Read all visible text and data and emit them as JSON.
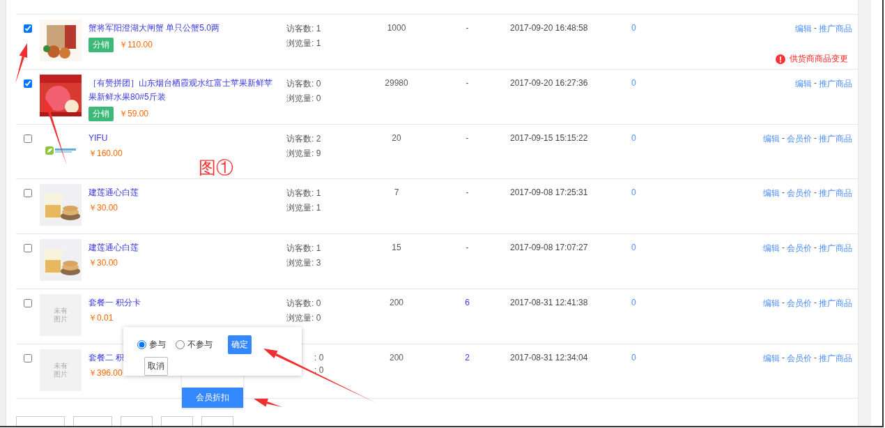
{
  "products": [
    {
      "checked": true,
      "image": {
        "kind": "picture"
      },
      "title": "蟹将军阳澄湖大闸蟹 单只公蟹5.0两",
      "badge": "分销",
      "price": "￥110.00",
      "stats": [
        "访客数: 1",
        "浏览量: 1"
      ],
      "stock": "1000",
      "column_5": {
        "text": "-",
        "link": false
      },
      "created": "2017-09-20 16:48:58",
      "column_7": "0",
      "actions": [
        {
          "kind": "link",
          "text": "编辑"
        },
        {
          "kind": "separator",
          "text": "-"
        },
        {
          "kind": "link",
          "text": "推广商品"
        }
      ],
      "warning": "供货商商品变更"
    },
    {
      "checked": true,
      "image": {
        "kind": "picture"
      },
      "title": "［有赞拼团］山东烟台栖霞观水红富士苹果新鲜苹果新鲜水果80#5斤装",
      "badge": "分销",
      "price": "￥59.00",
      "stats": [
        "访客数: 0",
        "浏览量: 0"
      ],
      "stock": "29980",
      "column_5": {
        "text": "-",
        "link": false
      },
      "created": "2017-09-20 16:27:36",
      "column_7": "0",
      "actions": [
        {
          "kind": "link",
          "text": "编辑"
        },
        {
          "kind": "separator",
          "text": "-"
        },
        {
          "kind": "link",
          "text": "推广商品"
        }
      ]
    },
    {
      "checked": false,
      "image": {
        "kind": "logo"
      },
      "title": "YIFU",
      "price": "￥160.00",
      "stats": [
        "访客数: 2",
        "浏览量: 9"
      ],
      "stock": "20",
      "column_5": {
        "text": "-",
        "link": false
      },
      "created": "2017-09-15 15:15:22",
      "column_7": "0",
      "actions": [
        {
          "kind": "link",
          "text": "编辑"
        },
        {
          "kind": "separator",
          "text": "-"
        },
        {
          "kind": "link",
          "text": "会员价"
        },
        {
          "kind": "separator",
          "text": "-"
        },
        {
          "kind": "link",
          "text": "推广商品"
        }
      ]
    },
    {
      "checked": false,
      "image": {
        "kind": "picture"
      },
      "title": "建莲通心白莲",
      "price": "￥30.00",
      "stats": [
        "访客数: 1",
        "浏览量: 1"
      ],
      "stock": "7",
      "column_5": {
        "text": "-",
        "link": false
      },
      "created": "2017-09-08 17:25:31",
      "column_7": "0",
      "actions": [
        {
          "kind": "link",
          "text": "编辑"
        },
        {
          "kind": "separator",
          "text": "-"
        },
        {
          "kind": "link",
          "text": "会员价"
        },
        {
          "kind": "separator",
          "text": "-"
        },
        {
          "kind": "link",
          "text": "推广商品"
        }
      ]
    },
    {
      "checked": false,
      "image": {
        "kind": "picture"
      },
      "title": "建莲通心白莲",
      "price": "￥30.00",
      "stats": [
        "访客数: 1",
        "浏览量: 3"
      ],
      "stock": "15",
      "column_5": {
        "text": "-",
        "link": false
      },
      "created": "2017-09-08 17:07:27",
      "column_7": "0",
      "actions": [
        {
          "kind": "link",
          "text": "编辑"
        },
        {
          "kind": "separator",
          "text": "-"
        },
        {
          "kind": "link",
          "text": "会员价"
        },
        {
          "kind": "separator",
          "text": "-"
        },
        {
          "kind": "link",
          "text": "推广商品"
        }
      ]
    },
    {
      "checked": false,
      "image": {
        "kind": "placeholder",
        "text": [
          "未有",
          "图片"
        ]
      },
      "title": "套餐一 积分卡",
      "price": "￥0.01",
      "stats": [
        "访客数: 0",
        "浏览量: 0"
      ],
      "stock": "200",
      "column_5": {
        "text": "6",
        "link": true
      },
      "created": "2017-08-31 12:41:38",
      "column_7": "0",
      "actions": [
        {
          "kind": "link",
          "text": "编辑"
        },
        {
          "kind": "separator",
          "text": "-"
        },
        {
          "kind": "link",
          "text": "会员价"
        },
        {
          "kind": "separator",
          "text": "-"
        },
        {
          "kind": "link",
          "text": "推广商品"
        }
      ]
    },
    {
      "checked": false,
      "image": {
        "kind": "placeholder",
        "text": [
          "未有",
          "图片"
        ]
      },
      "title": "套餐二 积",
      "price": "￥396.00",
      "stats": [
        ": 0",
        ": 0"
      ],
      "stats_partly_covered": true,
      "stock": "200",
      "column_5": {
        "text": "2",
        "link": true
      },
      "created": "2017-08-31 12:34:04",
      "column_7": "0",
      "actions": [
        {
          "kind": "link",
          "text": "编辑"
        },
        {
          "kind": "separator",
          "text": "-"
        },
        {
          "kind": "link",
          "text": "会员价"
        },
        {
          "kind": "separator",
          "text": "-"
        },
        {
          "kind": "link",
          "text": "推广商品"
        }
      ]
    }
  ],
  "popover": {
    "options": [
      {
        "label": "参与",
        "selected": true
      },
      {
        "label": "不参与",
        "selected": false
      }
    ],
    "confirm": "确定",
    "cancel": "取消"
  },
  "menu_item": "会员折扣",
  "annotation": "图①"
}
